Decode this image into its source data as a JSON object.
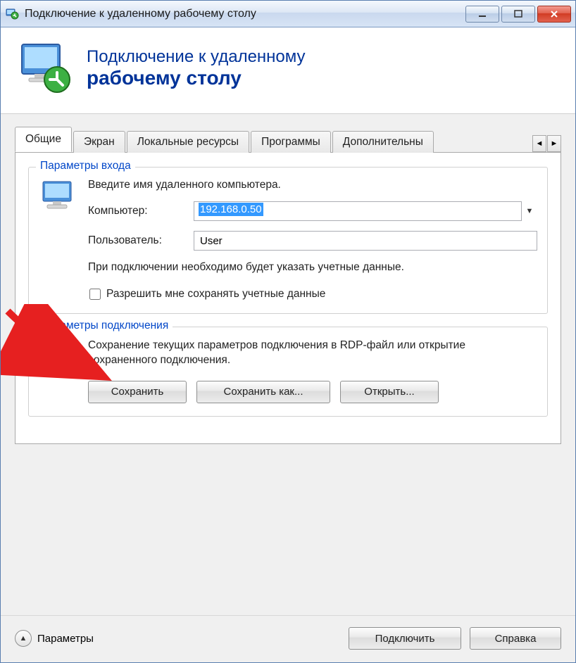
{
  "titlebar": {
    "title": "Подключение к удаленному рабочему столу"
  },
  "header": {
    "line1": "Подключение к удаленному",
    "line2": "рабочему столу"
  },
  "tabs": {
    "items": [
      {
        "label": "Общие"
      },
      {
        "label": "Экран"
      },
      {
        "label": "Локальные ресурсы"
      },
      {
        "label": "Программы"
      },
      {
        "label": "Дополнительны"
      }
    ],
    "active_index": 0
  },
  "login_group": {
    "title": "Параметры входа",
    "instruction": "Введите имя удаленного компьютера.",
    "computer_label": "Компьютер:",
    "computer_value": "192.168.0.50",
    "user_label": "Пользователь:",
    "user_value": "User",
    "note": "При подключении необходимо будет указать учетные данные.",
    "checkbox_label": "Разрешить мне сохранять учетные данные",
    "checkbox_checked": false
  },
  "connection_group": {
    "title": "Параметры подключения",
    "note": "Сохранение текущих параметров подключения в RDP-файл или открытие сохраненного подключения.",
    "save_label": "Сохранить",
    "save_as_label": "Сохранить как...",
    "open_label": "Открыть..."
  },
  "footer": {
    "params_label": "Параметры",
    "connect_label": "Подключить",
    "help_label": "Справка"
  }
}
